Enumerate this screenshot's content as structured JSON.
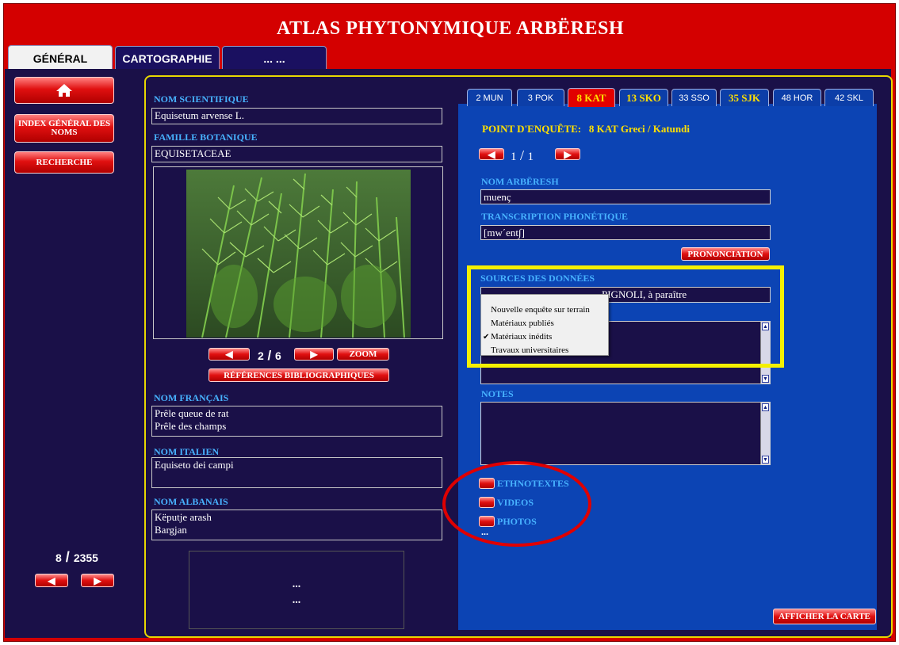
{
  "app": {
    "title": "ATLAS PHYTONYMIQUE ARBËRESH"
  },
  "tabs": [
    "GÉNÉRAL",
    "CARTOGRAPHIE",
    "... ..."
  ],
  "sidebar": {
    "home_icon": "home-icon",
    "index_label": "INDEX GÉNÉRAL DES NOMS",
    "search_label": "RECHERCHE",
    "counter_current": "8",
    "counter_total": "2355"
  },
  "plant": {
    "sci_label": "NOM SCIENTIFIQUE",
    "sci_value": "Equisetum arvense L.",
    "family_label": "FAMILLE BOTANIQUE",
    "family_value": "EQUISETACEAE",
    "image_index": "2",
    "image_total": "6",
    "zoom_label": "ZOOM",
    "refs_label": "RÉFÉRENCES BIBLIOGRAPHIQUES",
    "fr_label": "NOM FRANÇAIS",
    "fr_value": "Prêle queue de rat\nPrêle des champs",
    "it_label": "NOM ITALIEN",
    "it_value": "Equiseto dei campi",
    "al_label": "NOM ALBANAIS",
    "al_value": "Këputje arash\nBargjan",
    "bottom_placeholder_1": "...",
    "bottom_placeholder_2": "..."
  },
  "points": {
    "tabs": [
      "2 MUN",
      "3 POK",
      "8 KAT",
      "13 SKO",
      "33 SSO",
      "35 SJK",
      "48 HOR",
      "42 SKL"
    ],
    "selected_tab": "8 KAT"
  },
  "detail": {
    "point_label": "POINT D'ENQUÊTE:",
    "point_value": "8 KAT Greci / Katundi",
    "nav_current": "1",
    "nav_total": "1",
    "arb_label": "NOM ARBËRESH",
    "arb_value": "muenç",
    "phon_label": "TRANSCRIPTION PHONÉTIQUE",
    "phon_value": "[mw΄ent∫]",
    "pron_label": "PRONONCIATION",
    "sources_label": "SOURCES DES DONNÉES",
    "sources_value": "PIGNOLI, à paraître",
    "notes_label": "NOTES",
    "media": [
      "ETHNOTEXTES",
      "VIDEOS",
      "PHOTOS"
    ],
    "more": "...",
    "map_label": "AFFICHER LA CARTE"
  },
  "sources_menu": {
    "items": [
      "Nouvelle enquête sur terrain",
      "Matériaux publiés",
      "Matériaux inédits",
      "Travaux universitaires"
    ],
    "checked": "Matériaux inédits"
  },
  "colors": {
    "brand_red": "#d40000",
    "work_bg": "#1a1048",
    "panel_blue": "#0c44b4",
    "label_blue": "#47b2ff",
    "gold": "#ffe000",
    "annotation_yellow": "#f5f000",
    "annotation_red": "#e00000"
  }
}
